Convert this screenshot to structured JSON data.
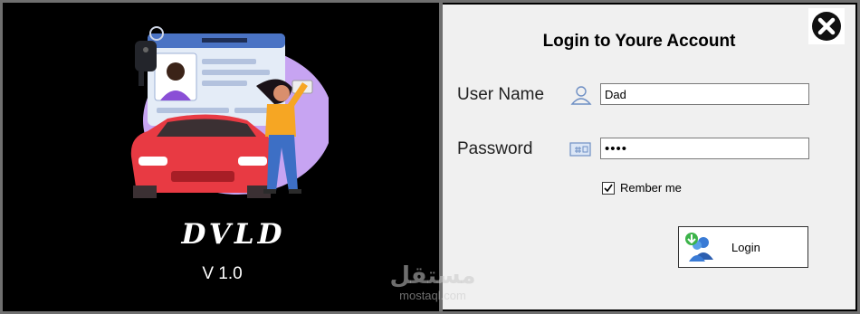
{
  "left_panel": {
    "app_title": "DVLD",
    "version": "V 1.0",
    "watermark": {
      "arabic": "مستقل",
      "latin": "mostaql.com"
    }
  },
  "login_form": {
    "title": "Login to Youre Account",
    "username_label": "User Name",
    "username_value": "Dad",
    "password_label": "Password",
    "password_value": "1234",
    "remember_label": "Rember me",
    "remember_checked": true,
    "login_button_label": "Login",
    "close_icon": "close-circle-icon"
  },
  "colors": {
    "panel_bg": "#f0f0f0",
    "left_bg": "#000000",
    "car_red": "#e83a43",
    "blob_purple": "#c7a4f2",
    "card_blue": "#4a73c4"
  }
}
